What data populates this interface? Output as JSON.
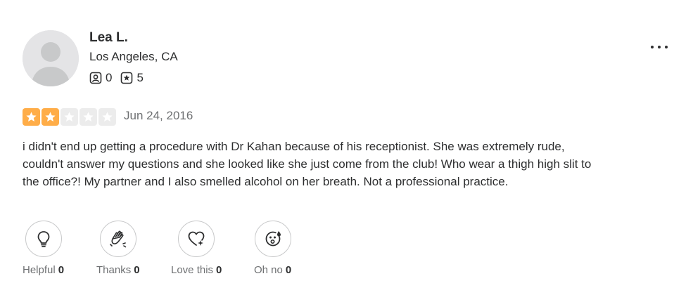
{
  "user": {
    "name": "Lea L.",
    "location": "Los Angeles, CA",
    "friends_count": "0",
    "reviews_count": "5"
  },
  "review": {
    "rating": 2,
    "max_rating": 5,
    "date": "Jun 24, 2016",
    "text": "i didn't end up getting a procedure with Dr Kahan because of his receptionist. She was extremely rude, couldn't answer my questions and she looked like she just come from the club! Who wear a thigh high slit to the office?! My partner and I also smelled alcohol on her breath. Not a professional practice."
  },
  "reactions": [
    {
      "label": "Helpful",
      "count": "0",
      "icon": "lightbulb-icon"
    },
    {
      "label": "Thanks",
      "count": "0",
      "icon": "high-five-icon"
    },
    {
      "label": "Love this",
      "count": "0",
      "icon": "heart-sparkle-icon"
    },
    {
      "label": "Oh no",
      "count": "0",
      "icon": "surprised-face-icon"
    }
  ],
  "colors": {
    "star_filled": "#ffad48",
    "star_empty": "#ececec",
    "text": "#2d2e2f",
    "muted": "#6e7072"
  }
}
